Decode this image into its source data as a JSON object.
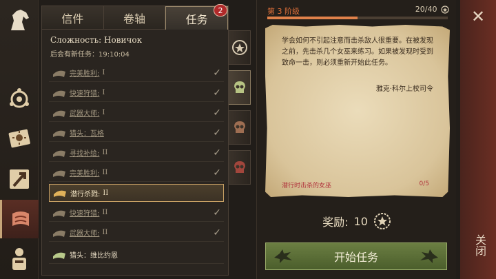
{
  "tabs": [
    {
      "label": "信件"
    },
    {
      "label": "卷轴"
    },
    {
      "label": "任务"
    }
  ],
  "tab_badge": "2",
  "difficulty": "Сложность: Новичок",
  "next_quest": "后会有新任务：19:10:04",
  "quests": [
    {
      "name": "完美胜利:",
      "tier": "I",
      "done": true
    },
    {
      "name": "快速狩猎:",
      "tier": "I",
      "done": true
    },
    {
      "name": "武器大师:",
      "tier": "I",
      "done": true
    },
    {
      "name": "猎头：瓦格",
      "tier": "",
      "done": true
    },
    {
      "name": "寻找补给:",
      "tier": "II",
      "done": true
    },
    {
      "name": "完美胜利:",
      "tier": "II",
      "done": true
    },
    {
      "name": "潜行杀戮:",
      "tier": "II",
      "done": false,
      "selected": true
    },
    {
      "name": "快速狩猎:",
      "tier": "II",
      "done": true
    },
    {
      "name": "武器大师:",
      "tier": "II",
      "done": true
    },
    {
      "name": "猎头：维比约恩",
      "tier": "",
      "done": false,
      "current": true
    }
  ],
  "stage": {
    "label": "第 3 阶级",
    "count": "20/40",
    "progress": 0.5
  },
  "briefing": {
    "text": "学会如何不引起注意而击杀敌人很重要。在被发现之前，先击杀几个女巫来练习。如果被发现时受到致命一击，则必须重新开始此任务。",
    "signature": "雅克·科尔上校司令",
    "objective": "潜行时击杀的女巫",
    "objective_count": "0/5"
  },
  "reward": {
    "label": "奖励:",
    "value": "10"
  },
  "start_button": "开始任务",
  "close_label": "关闭",
  "colors": {
    "accent_orange": "#e1703a",
    "objective_red": "#b0303a",
    "start_green": "#5c7036",
    "badge_red": "#b02a2a"
  },
  "icons": {
    "sidebar": [
      "horse-head-icon",
      "faction-emblem-icon",
      "sun-book-icon",
      "map-arrow-icon",
      "scroll-icon",
      "character-icon"
    ],
    "categories": [
      "star-badge-icon",
      "skull-green-icon",
      "skull-brown-icon",
      "skull-red-icon"
    ]
  }
}
